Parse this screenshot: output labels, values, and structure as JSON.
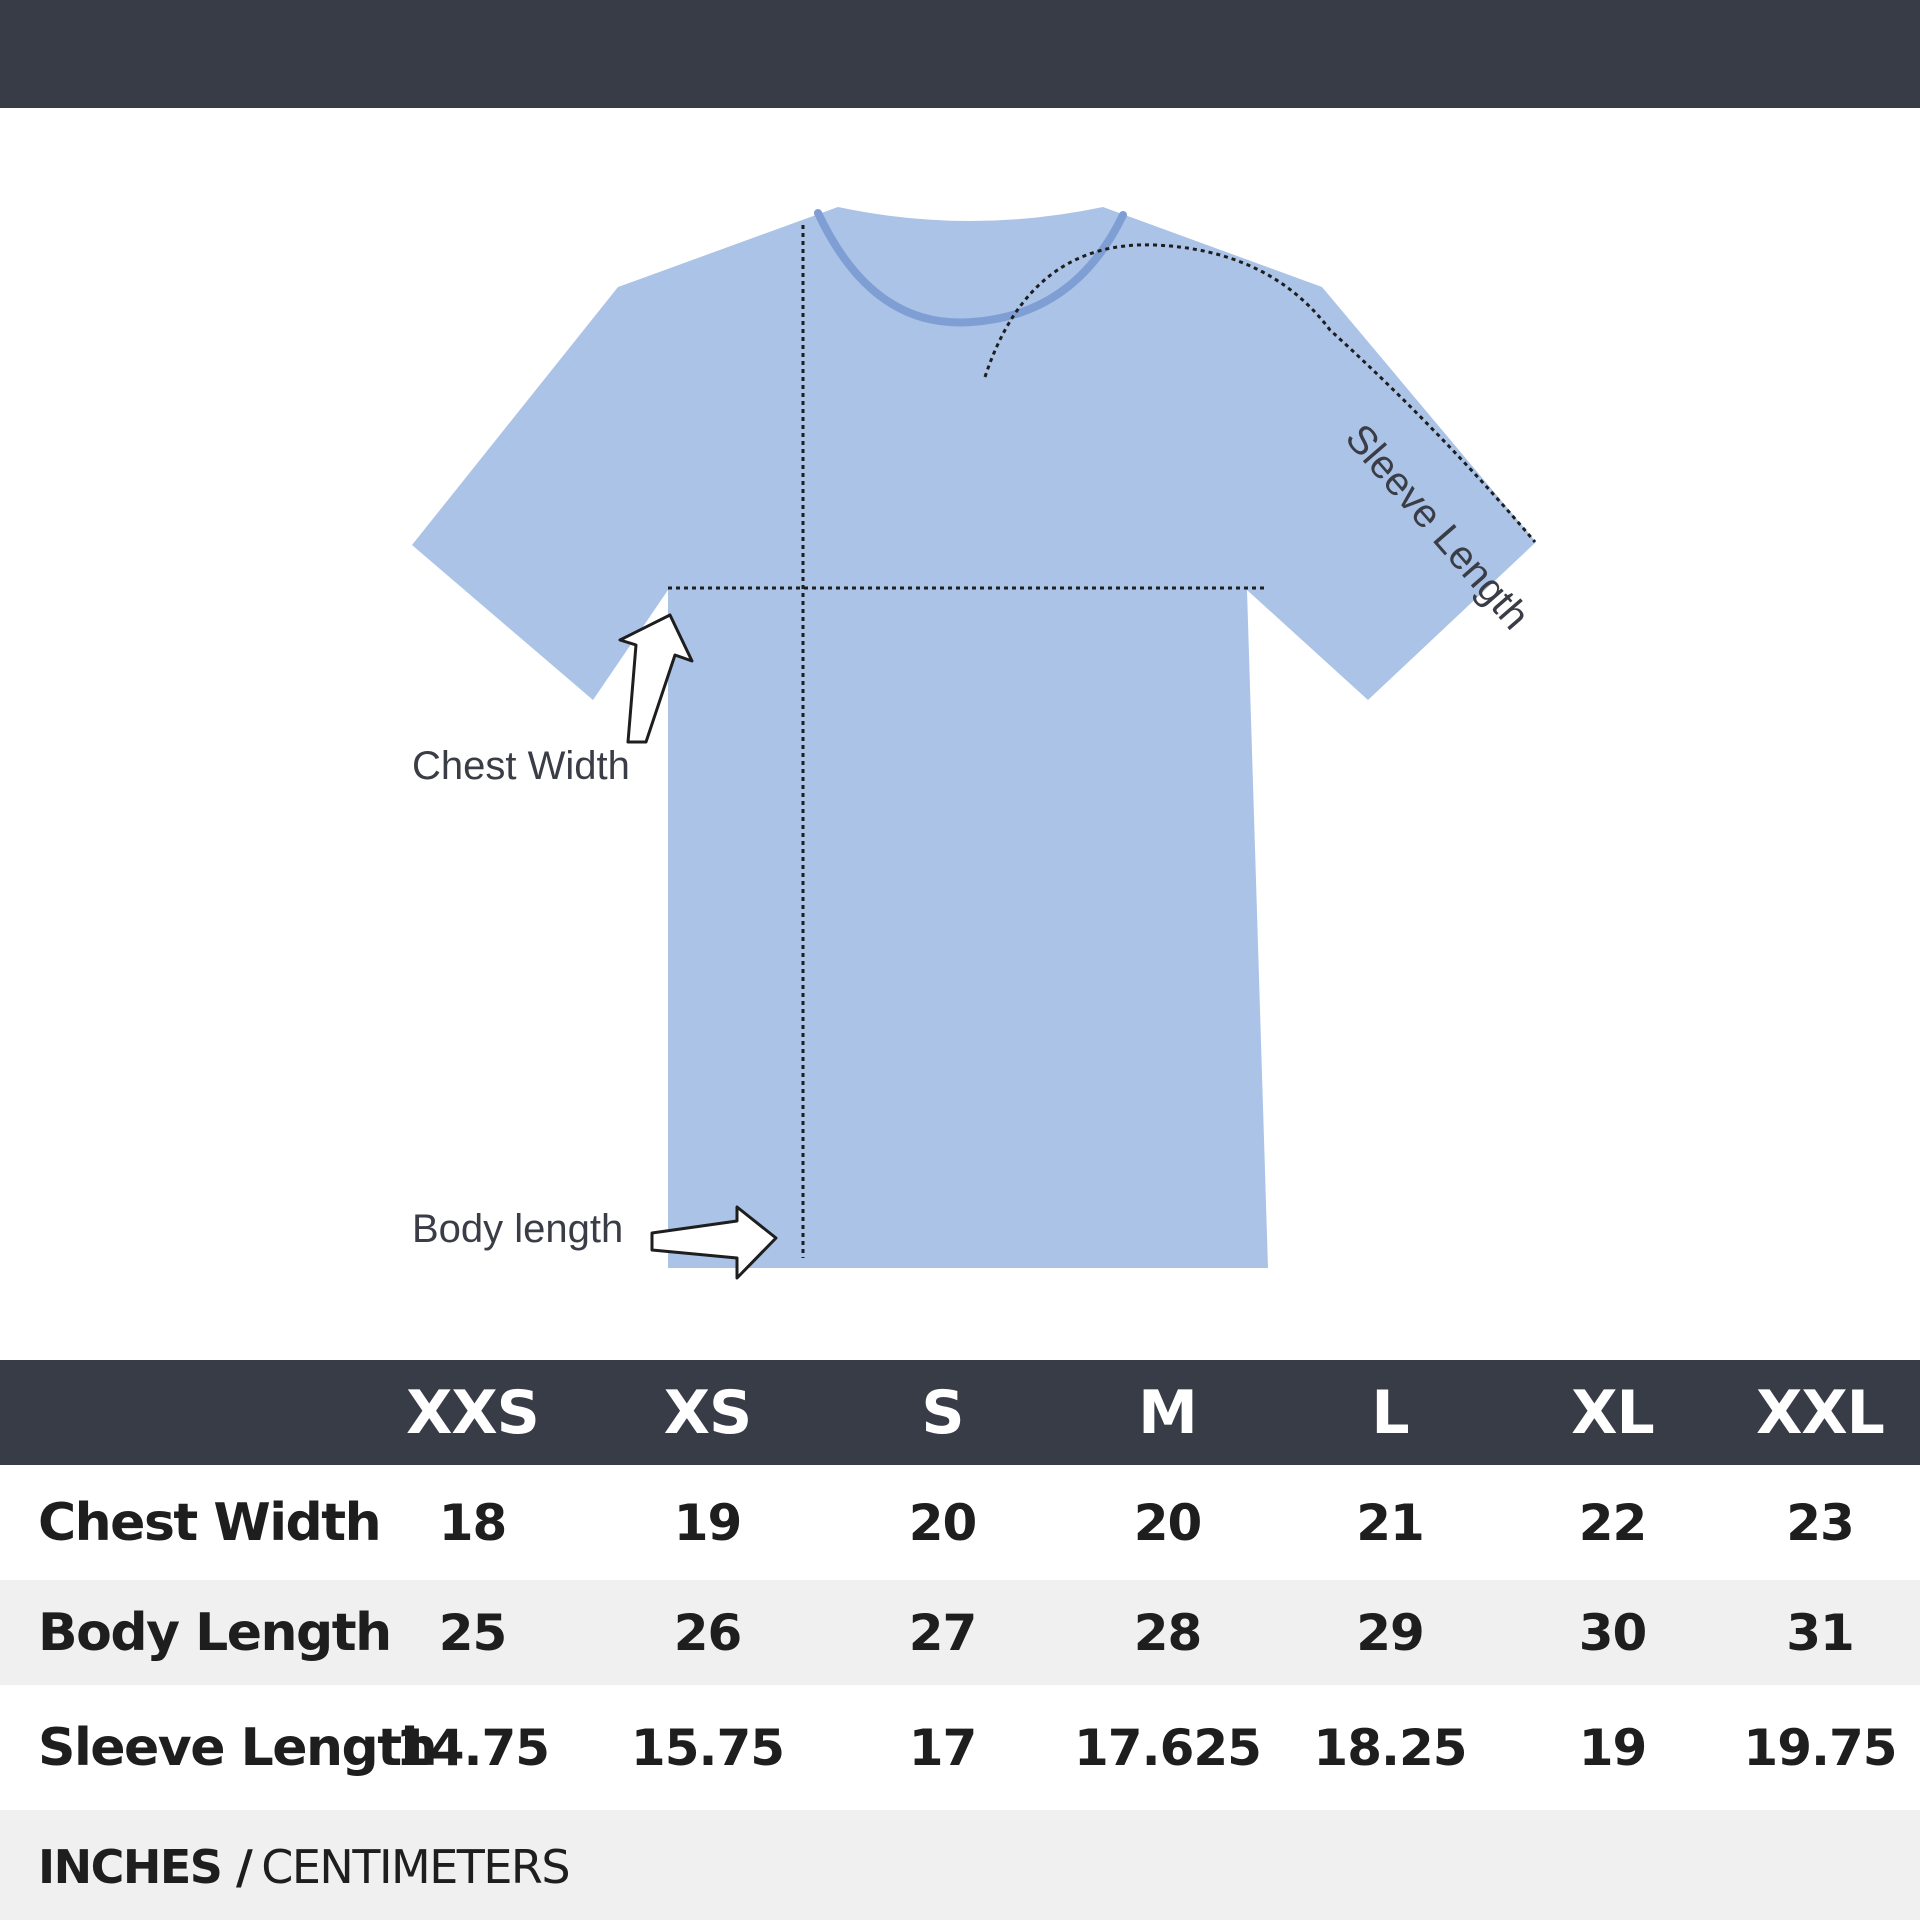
{
  "diagram": {
    "shirt_color": "#aac3e7",
    "collar_color": "#7f9fd4",
    "labels": {
      "chest": "Chest Width",
      "body": "Body length",
      "sleeve": "Sleeve Length"
    }
  },
  "table": {
    "header_color": "#383c47",
    "sizes": [
      "XXS",
      "XS",
      "S",
      "M",
      "L",
      "XL",
      "XXL"
    ],
    "rows": [
      {
        "label": "Chest Width",
        "values": [
          "18",
          "19",
          "20",
          "20",
          "21",
          "22",
          "23"
        ]
      },
      {
        "label": "Body Length",
        "values": [
          "25",
          "26",
          "27",
          "28",
          "29",
          "30",
          "31"
        ]
      },
      {
        "label": "Sleeve Length",
        "values": [
          "14.75",
          "15.75",
          "17",
          "17.625",
          "18.25",
          "19",
          "19.75"
        ]
      }
    ]
  },
  "units": {
    "active": "INCHES /",
    "inactive": "CENTIMETERS"
  }
}
